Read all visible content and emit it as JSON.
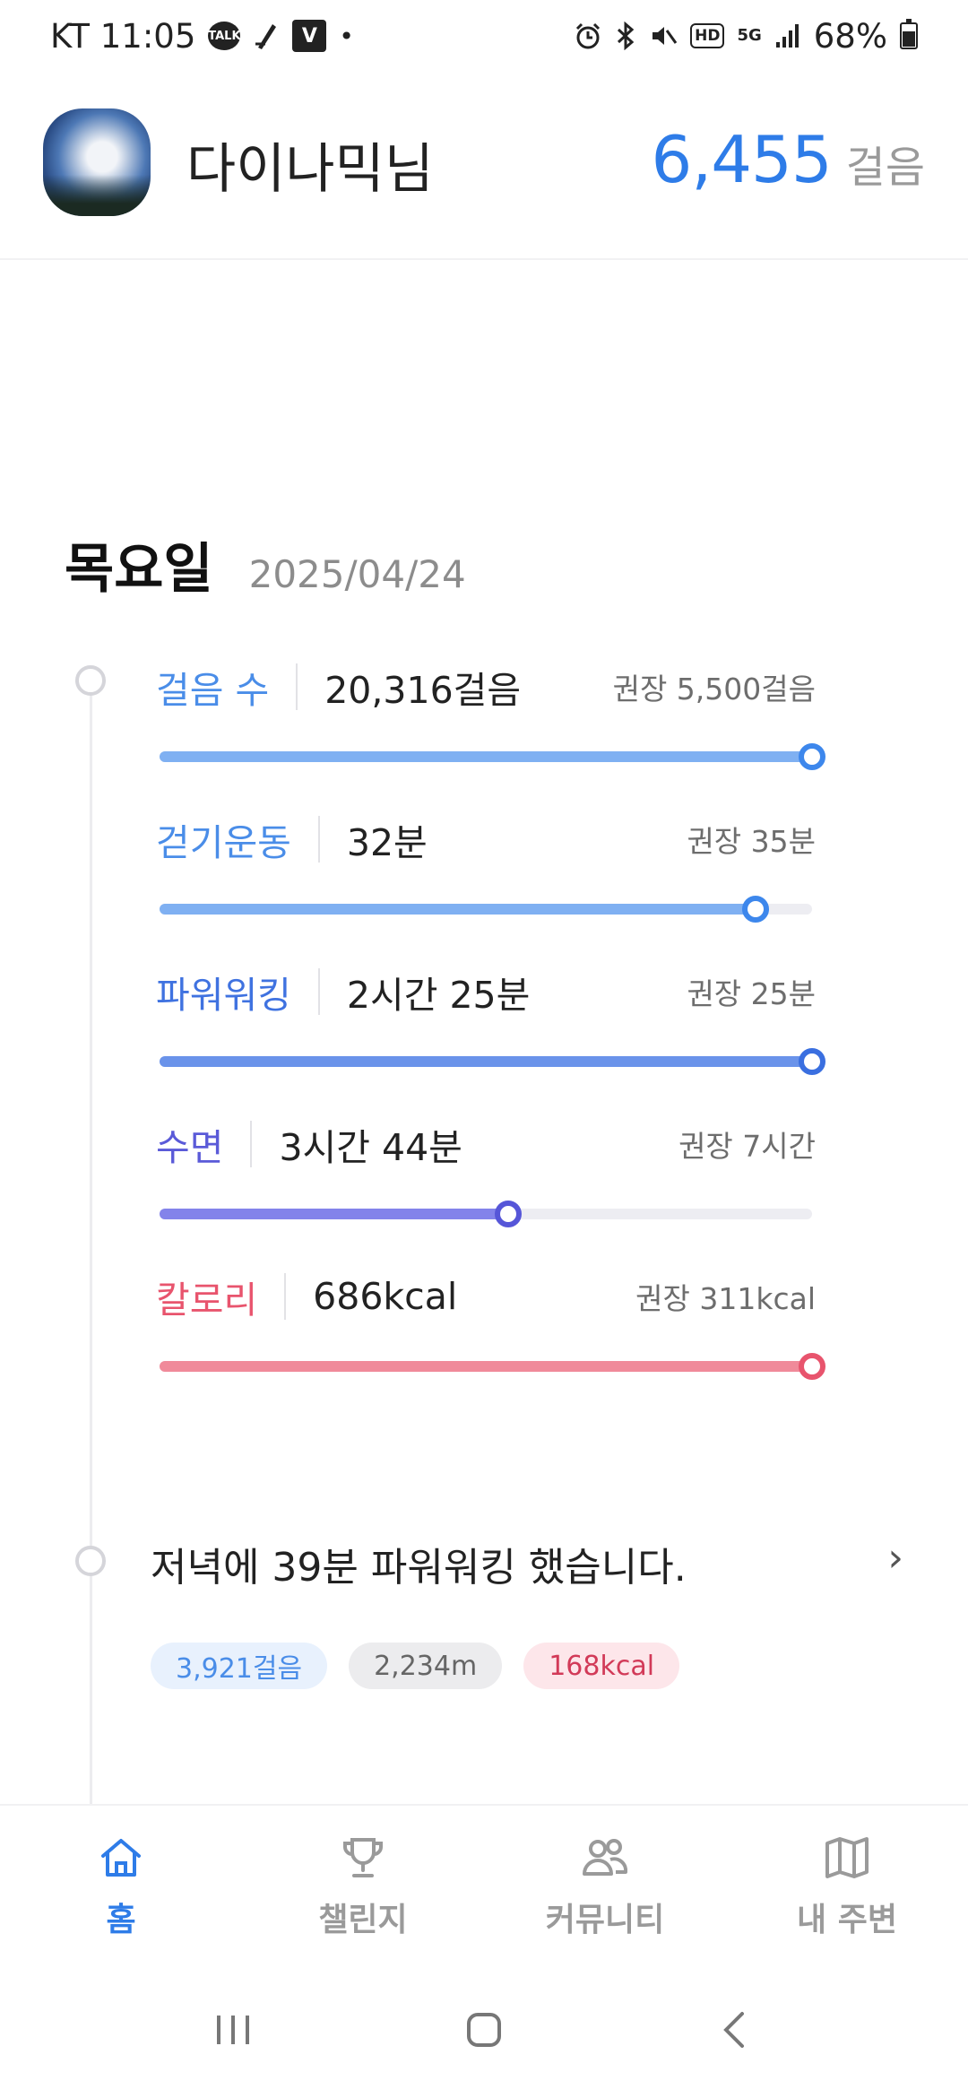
{
  "status_bar": {
    "carrier_time": "KT 11:05",
    "talk_icon_text": "TALK",
    "v_icon_text": "V",
    "dot": "•",
    "hd_text": "HD",
    "fiveg_text": "5G",
    "battery": "68%"
  },
  "header": {
    "username": "다이나믹님",
    "steps_value": "6,455",
    "steps_unit": "걸음"
  },
  "day": {
    "weekday": "목요일",
    "date": "2025/04/24"
  },
  "metrics": [
    {
      "label": "걸음 수",
      "value": "20,316걸음",
      "recommended": "권장 5,500걸음",
      "progress": 1.0,
      "color": "#7fb0f2",
      "knob_color": "#3d87ec",
      "label_color": "#4a8de8"
    },
    {
      "label": "걷기운동",
      "value": "32분",
      "recommended": "권장 35분",
      "progress": 0.914,
      "color": "#7fb0f2",
      "knob_color": "#3d87ec",
      "label_color": "#4a8de8"
    },
    {
      "label": "파워워킹",
      "value": "2시간 25분",
      "recommended": "권장 25분",
      "progress": 1.0,
      "color": "#6a93ea",
      "knob_color": "#3a6fe0",
      "label_color": "#3f72e0"
    },
    {
      "label": "수면",
      "value": "3시간 44분",
      "recommended": "권장 7시간",
      "progress": 0.534,
      "color": "#8383ea",
      "knob_color": "#5656d8",
      "label_color": "#5a5ad8"
    },
    {
      "label": "칼로리",
      "value": "686kcal",
      "recommended": "권장 311kcal",
      "progress": 1.0,
      "color": "#f08a9a",
      "knob_color": "#e8546d",
      "label_color": "#e8546d"
    }
  ],
  "activity": {
    "message": "저녁에 39분 파워워킹 했습니다.",
    "chevron": "›",
    "chips": [
      {
        "text": "3,921걸음",
        "bg": "#e8f1fd",
        "fg": "#4a8de8"
      },
      {
        "text": "2,234m",
        "bg": "#ececee",
        "fg": "#666666"
      },
      {
        "text": "168kcal",
        "bg": "#fde6ea",
        "fg": "#d23a58"
      }
    ]
  },
  "bottom_nav": [
    {
      "label": "홈",
      "icon": "home-icon",
      "active": true
    },
    {
      "label": "챌린지",
      "icon": "trophy-icon",
      "active": false
    },
    {
      "label": "커뮤니티",
      "icon": "people-icon",
      "active": false
    },
    {
      "label": "내 주변",
      "icon": "map-icon",
      "active": false
    }
  ],
  "colors": {
    "accent": "#2e7ce8",
    "inactive": "#9a9a9a"
  }
}
